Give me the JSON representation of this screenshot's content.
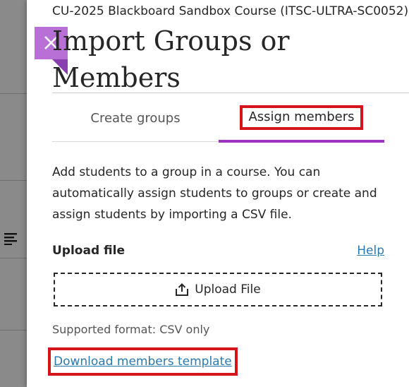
{
  "course": {
    "name": "CU-2025 Blackboard Sandbox Course (ITSC-ULTRA-SC0052)"
  },
  "panel": {
    "title": "Import Groups or Members",
    "close_icon": "close-icon"
  },
  "tabs": [
    {
      "label": "Create groups",
      "active": false
    },
    {
      "label": "Assign members",
      "active": true
    }
  ],
  "description": "Add students to a group in a course. You can automatically assign students to groups or create and assign students by importing a CSV file.",
  "upload": {
    "label": "Upload file",
    "help_label": "Help",
    "button_label": "Upload File",
    "button_icon": "upload-icon",
    "format_note": "Supported format: CSV only"
  },
  "download_template_label": "Download members template",
  "colors": {
    "accent_purple": "#9a34c0",
    "close_button": "#b86fd6",
    "highlight_red": "#d4141c",
    "link_blue": "#2a7ab0"
  }
}
